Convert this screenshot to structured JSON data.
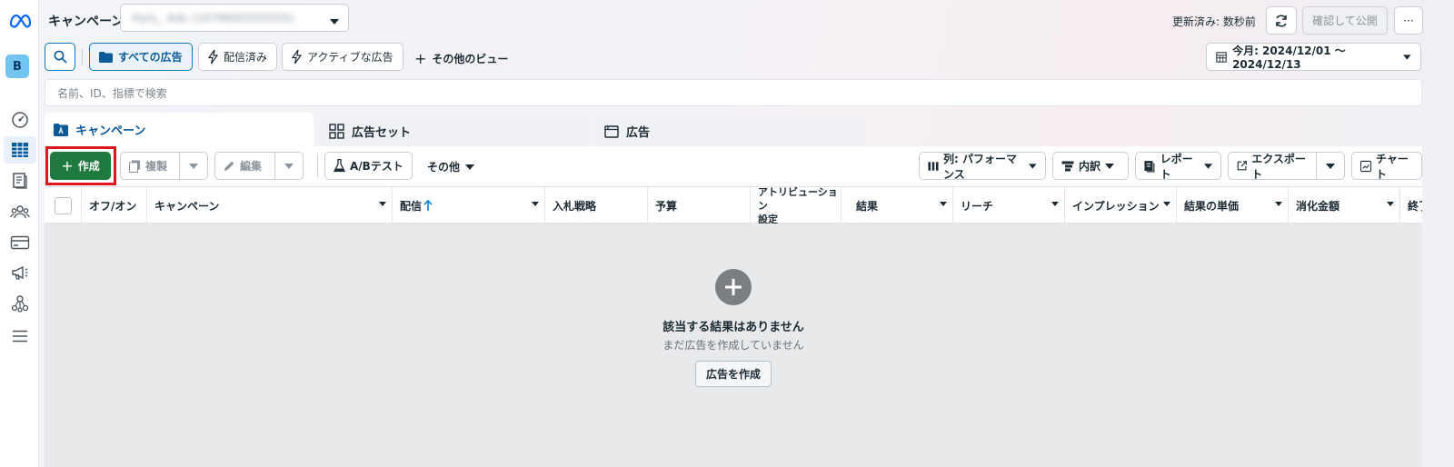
{
  "rail": {
    "avatar_letter": "B",
    "icons": [
      "meta-logo-icon",
      "dashboard-icon",
      "table-icon",
      "pages-icon",
      "audience-icon",
      "billing-icon",
      "megaphone-icon",
      "hierarchy-icon",
      "menu-icon"
    ]
  },
  "topbar": {
    "title": "キャンペーン",
    "account_blurred": "Hylu_ Ads (1079605555555)",
    "updated": "更新済み: 数秒前",
    "publish": "確認して公開",
    "more": "···"
  },
  "views": {
    "all_ads": "すべての広告",
    "delivered": "配信済み",
    "active_ads": "アクティブな広告",
    "other_views": "その他のビュー",
    "date_range": "今月: 2024/12/01 〜 2024/12/13"
  },
  "search": {
    "placeholder": "名前、ID、指標で検索"
  },
  "tabs": {
    "campaign": "キャンペーン",
    "adset": "広告セット",
    "ad": "広告"
  },
  "toolbar": {
    "create": "作成",
    "duplicate": "複製",
    "edit": "編集",
    "ab_test": "A/Bテスト",
    "more": "その他",
    "columns": "列: パフォーマンス",
    "breakdown": "内訳",
    "report": "レポート",
    "export": "エクスポート",
    "chart": "チャート"
  },
  "table": {
    "columns": {
      "onoff": "オフ/オン",
      "campaign": "キャンペーン",
      "delivery": "配信",
      "bid": "入札戦略",
      "budget": "予算",
      "attribution_1": "アトリビューション",
      "attribution_2": "設定",
      "results": "結果",
      "reach": "リーチ",
      "impressions": "インプレッション",
      "cost_per_result": "結果の単価",
      "spend": "消化金額",
      "ends": "終了"
    }
  },
  "empty": {
    "title": "該当する結果はありません",
    "subtitle": "まだ広告を作成していません",
    "button": "広告を作成"
  },
  "colors": {
    "accent": "#0a78be",
    "create_green": "#1f7a3f",
    "highlight_red": "#e0161f"
  }
}
